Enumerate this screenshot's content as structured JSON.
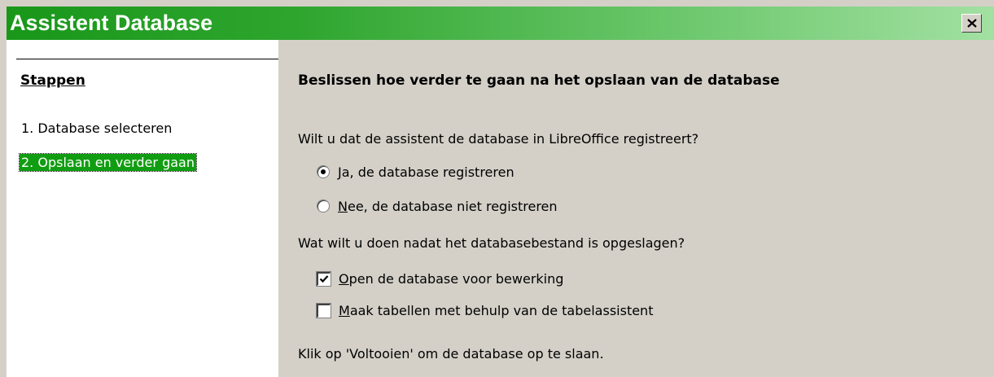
{
  "window": {
    "title": "Assistent Database",
    "close_label": "×"
  },
  "sidebar": {
    "title": "Stappen",
    "steps": [
      {
        "label": "1. Database selecteren",
        "active": false
      },
      {
        "label": "2. Opslaan en verder gaan",
        "active": true
      }
    ]
  },
  "main": {
    "heading": "Beslissen hoe verder te gaan na het opslaan van de database",
    "question_register": "Wilt u dat de assistent de database in LibreOffice registreert?",
    "radio_yes": {
      "mnemonic": "J",
      "rest": "a, de database registreren",
      "checked": true
    },
    "radio_no": {
      "mnemonic": "N",
      "rest": "ee, de database niet registreren",
      "checked": false
    },
    "question_after": "Wat wilt u doen nadat het databasebestand is opgeslagen?",
    "check_open": {
      "mnemonic": "O",
      "rest": "pen de database voor bewerking",
      "checked": true
    },
    "check_tables": {
      "mnemonic": "M",
      "rest": "aak tabellen met behulp van de tabelassistent",
      "checked": false
    },
    "footer": "Klik op 'Voltooien' om de database op te slaan."
  },
  "colors": {
    "title_gradient_start": "#199719",
    "title_gradient_end": "#a2e0a2",
    "active_step_bg": "#119d11",
    "dialog_bg": "#d4d0c8"
  }
}
